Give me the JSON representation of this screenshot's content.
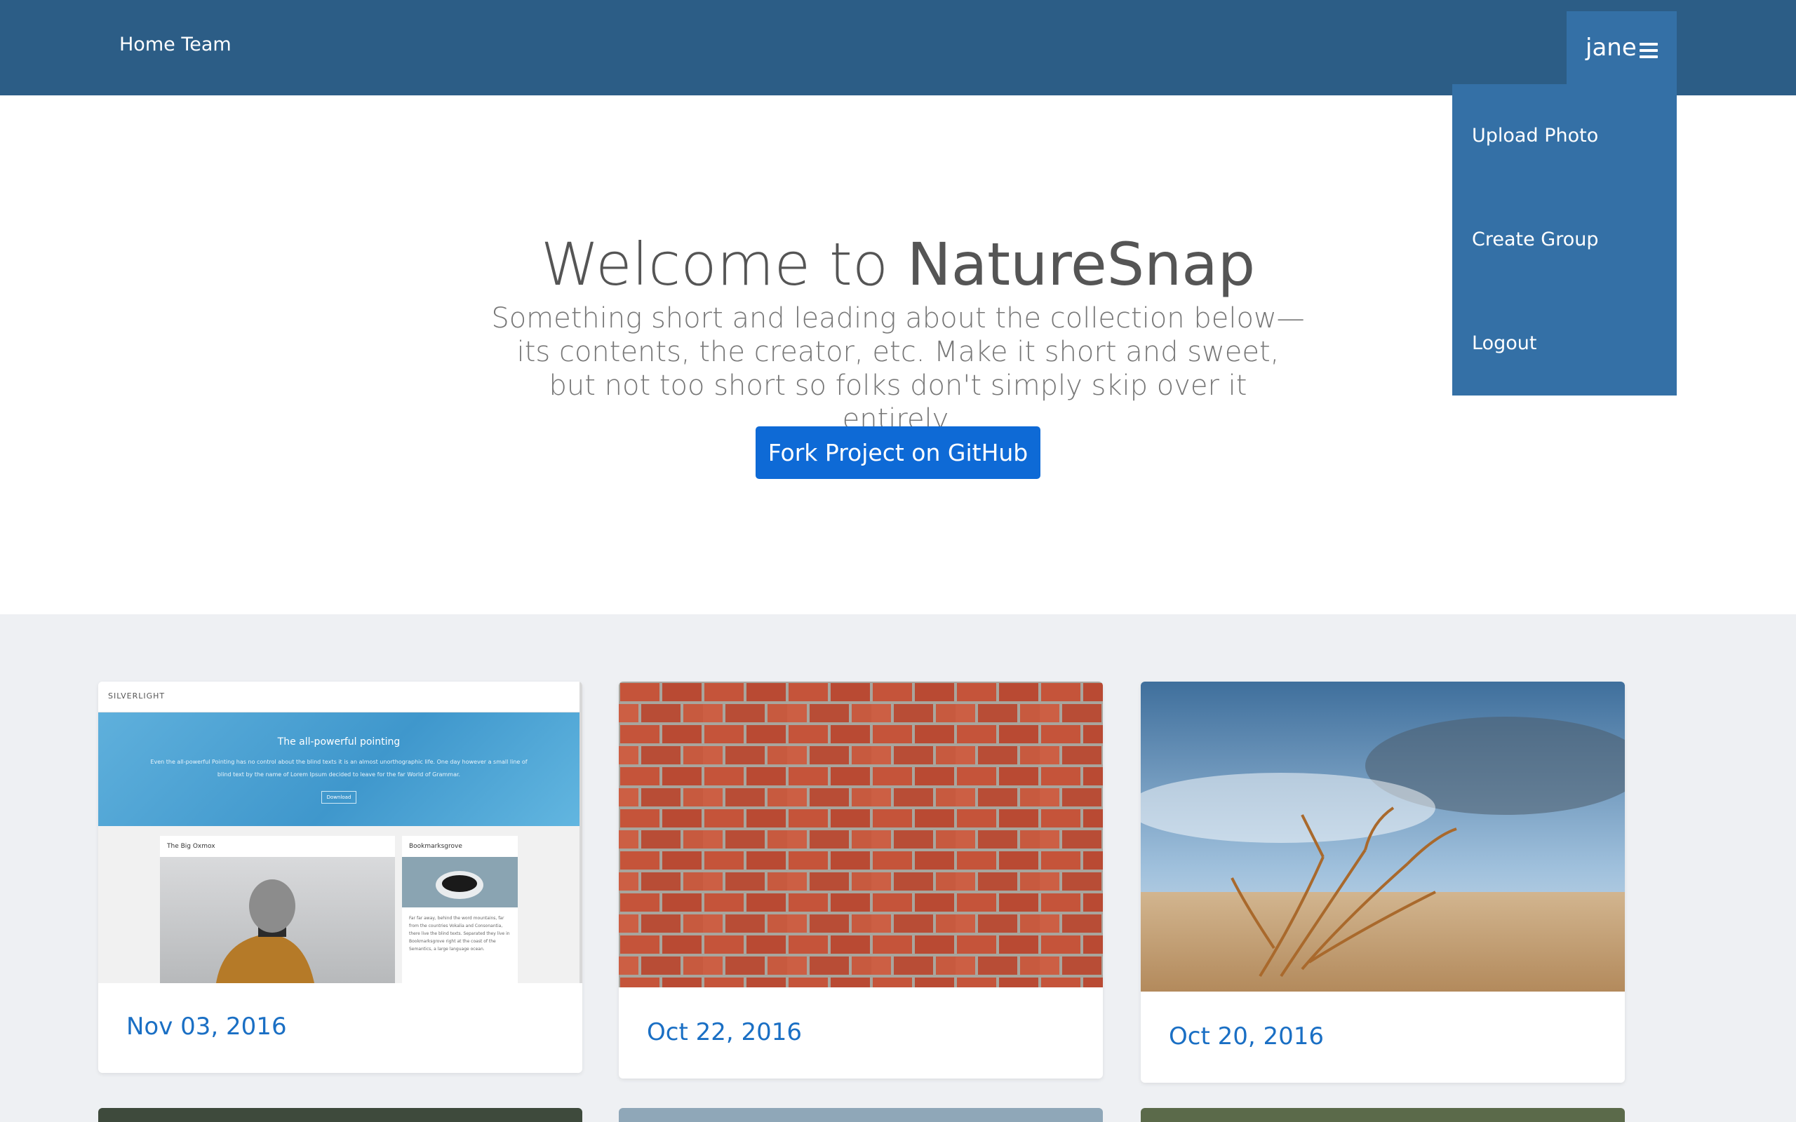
{
  "navbar": {
    "brand": "Home Team",
    "user": "jane"
  },
  "user_menu": {
    "items": [
      "Upload Photo",
      "Create Group",
      "Logout"
    ]
  },
  "hero": {
    "title_prefix": "Welcome to ",
    "title_brand": "NatureSnap",
    "lead": "Something short and leading about the collection below—its contents, the creator, etc. Make it short and sweet, but not too short so folks don't simply skip over it entirely.",
    "button": "Fork Project on GitHub"
  },
  "cards": [
    {
      "date": "Nov 03, 2016"
    },
    {
      "date": "Oct 22, 2016"
    },
    {
      "date": "Oct 20, 2016"
    }
  ],
  "thumbnail": {
    "brand": "SILVERLIGHT",
    "hero_title": "The all-powerful pointing",
    "hero_text": "Even the all-powerful Pointing has no control about the blind texts it is an almost unorthographic life. One day however a small line of blind text by the name of Lorem Ipsum decided to leave for the far World of Grammar.",
    "hero_button": "Download",
    "card1_title": "The Big Oxmox",
    "card2_title": "Bookmarksgrove",
    "card2_text": "Far far away, behind the word mountains, far from the countries Vokalia and Consonantia, there live the blind texts. Separated they live in Bookmarksgrove right at the coast of the Semantics, a large language ocean."
  },
  "colors": {
    "navbar": "#2c5d86",
    "dropdown": "#3470a6",
    "button": "#0e6ad6",
    "date": "#1a6fc4"
  }
}
